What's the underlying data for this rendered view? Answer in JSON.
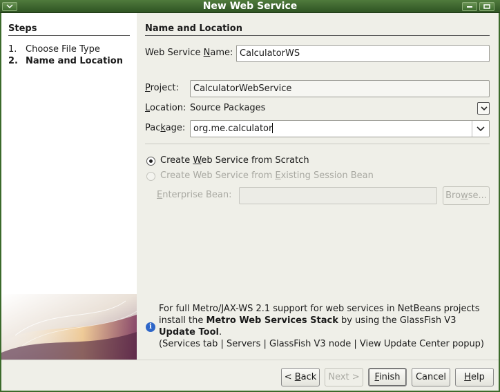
{
  "window": {
    "title": "New Web Service"
  },
  "steps": {
    "title": "Steps",
    "items": [
      {
        "num": "1.",
        "label": "Choose File Type"
      },
      {
        "num": "2.",
        "label": "Name and Location"
      }
    ]
  },
  "section": {
    "title": "Name and Location"
  },
  "form": {
    "ws_name_label_pre": "Web Service ",
    "ws_name_label_u": "N",
    "ws_name_label_post": "ame:",
    "ws_name_value": "CalculatorWS",
    "project_label_u": "P",
    "project_label_post": "roject:",
    "project_value": "CalculatorWebService",
    "location_label_u": "L",
    "location_label_post": "ocation:",
    "location_value": "Source Packages",
    "package_label_pre": "Pac",
    "package_label_u": "k",
    "package_label_post": "age:",
    "package_value": "org.me.calculator"
  },
  "options": {
    "scratch_pre": "Create ",
    "scratch_u": "W",
    "scratch_post": "eb Service from Scratch",
    "existing_pre": "Create Web Service from ",
    "existing_u": "E",
    "existing_post": "xisting Session Bean",
    "bean_label_u": "E",
    "bean_label_post": "nterprise Bean:",
    "bean_value": "",
    "browse_pre": "Bro",
    "browse_u": "w",
    "browse_post": "se..."
  },
  "info": {
    "line1": "For full Metro/JAX-WS 2.1 support for web services in NetBeans projects",
    "line2_pre": "install the ",
    "line2_bold": "Metro Web Services Stack",
    "line2_post": " by using the GlassFish V3",
    "line3_bold": "Update Tool",
    "line3_post": ".",
    "line4": "(Services tab | Servers | GlassFish V3 node | View Update Center popup)"
  },
  "buttons": {
    "back_pre": "< ",
    "back_u": "B",
    "back_post": "ack",
    "next": "Next >",
    "finish_u": "F",
    "finish_post": "inish",
    "cancel": "Cancel",
    "help_u": "H",
    "help_post": "elp"
  },
  "colors": {
    "titlebar": "#3b6a2b",
    "info_icon": "#2e66c8",
    "disabled_text": "#a9a9a2"
  }
}
